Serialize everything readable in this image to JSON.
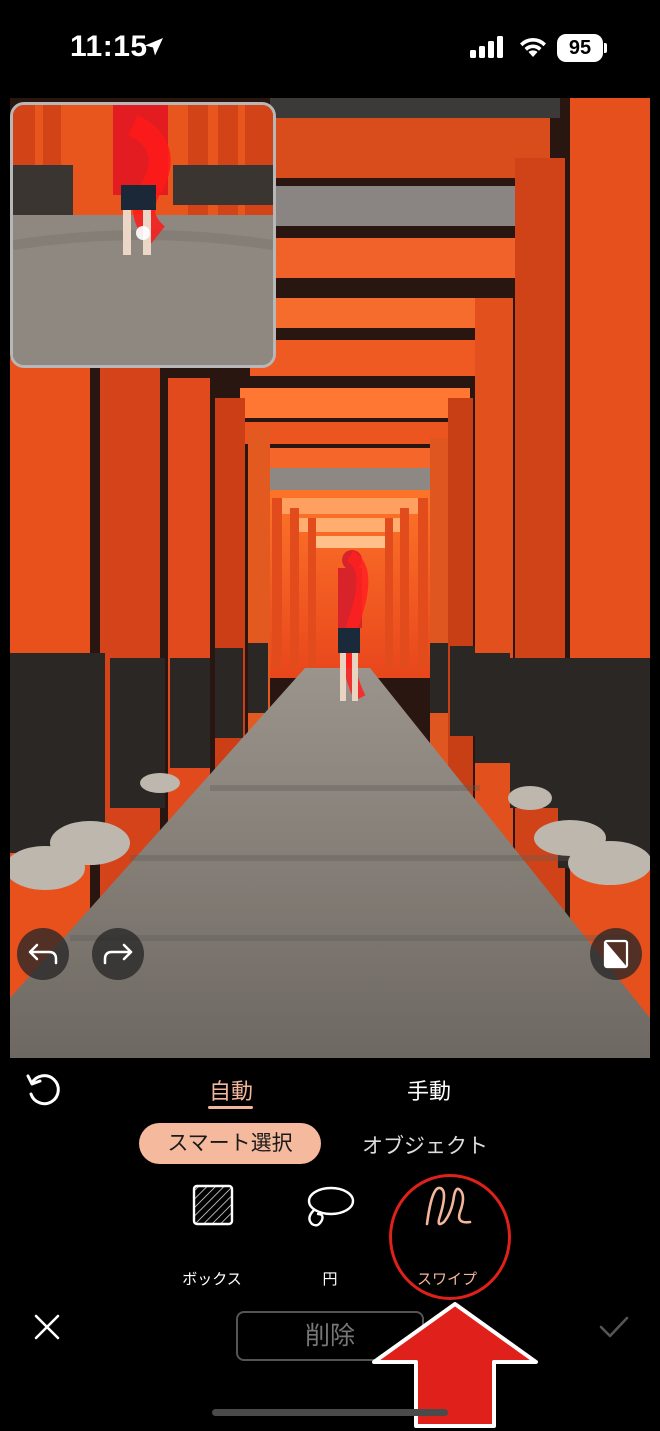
{
  "status_bar": {
    "time": "11:15",
    "battery": "95",
    "icons": [
      "location-arrow-icon",
      "signal-icon",
      "wifi-icon",
      "battery-icon"
    ]
  },
  "editor": {
    "image_description_icons": [
      "undo-icon",
      "redo-icon",
      "compare-icon"
    ]
  },
  "mode_tabs": {
    "auto": "自動",
    "manual": "手動",
    "active": "auto"
  },
  "selection_modes": {
    "smart": "スマート選択",
    "object": "オブジェクト",
    "active": "smart"
  },
  "tools": {
    "box": "ボックス",
    "circle": "円",
    "swipe": "スワイプ",
    "active": "swipe"
  },
  "actions": {
    "delete": "削除"
  },
  "colors": {
    "accent": "#f3b69a",
    "highlight": "#e0201a"
  }
}
